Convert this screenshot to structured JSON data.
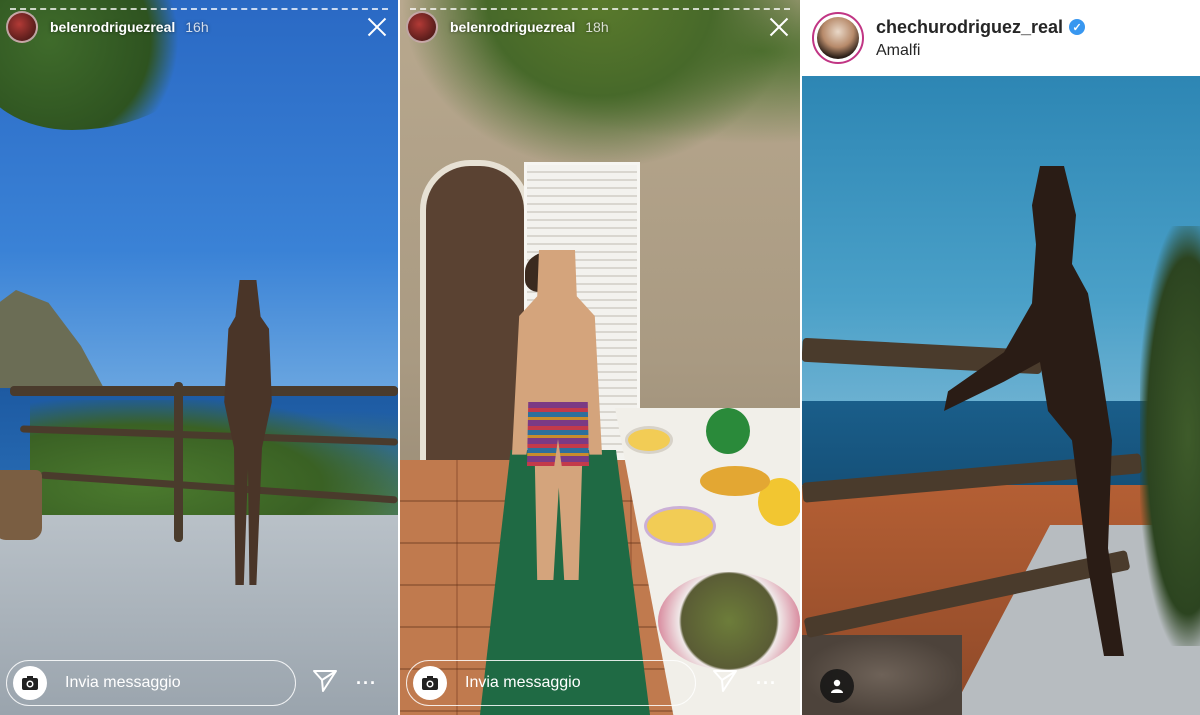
{
  "story_1": {
    "username": "belenrodriguezreal",
    "time": "16h",
    "reply_placeholder": "Invia messaggio"
  },
  "story_2": {
    "username": "belenrodriguezreal",
    "time": "18h",
    "reply_placeholder": "Invia messaggio"
  },
  "post": {
    "username": "chechurodriguez_real",
    "verified": true,
    "location": "Amalfi"
  },
  "icons": {
    "close": "close-icon",
    "camera": "camera-icon",
    "send": "send-icon",
    "more": "more-icon",
    "verified": "verified-badge-icon",
    "tagged_people": "person-icon"
  },
  "colors": {
    "verified_blue": "#3897f0",
    "avatar_ring": "#c13584"
  }
}
